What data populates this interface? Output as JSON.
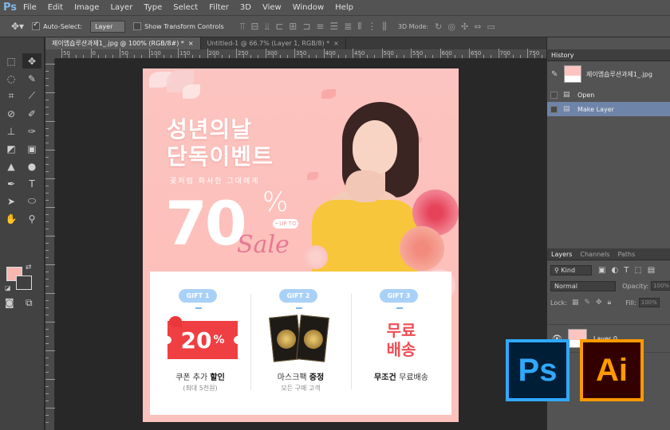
{
  "app": {
    "logo": "Ps"
  },
  "menu": [
    "File",
    "Edit",
    "Image",
    "Layer",
    "Type",
    "Select",
    "Filter",
    "3D",
    "View",
    "Window",
    "Help"
  ],
  "options": {
    "auto_select_label": "Auto-Select:",
    "auto_select_checked": true,
    "target_value": "Layer",
    "transform_label": "Show Transform Controls",
    "mode3d_label": "3D Mode:"
  },
  "tabs": [
    {
      "label": "제이엠숍루션과제1_.jpg @ 100% (RGB/8#) *",
      "active": true
    },
    {
      "label": "Untitled-1 @ 66.7% (Layer 1, RGB/8) *",
      "active": false
    }
  ],
  "ruler": {
    "h_labels": [
      "50",
      "0",
      "50",
      "100",
      "150",
      "200",
      "250",
      "300",
      "350",
      "400",
      "450",
      "500",
      "550",
      "600",
      "650",
      "700",
      "750"
    ]
  },
  "colors": {
    "foreground": "#f7b7b0",
    "background": "#404040",
    "artboard_pink": "#fcc4c0",
    "coupon_red": "#ef3f42",
    "gift_pill": "#a9d1f7",
    "ps_blue": "#31a8ff",
    "ai_orange": "#ff9a00"
  },
  "promo": {
    "headline_line1": "성년의날",
    "headline_line2": "단독이벤트",
    "subline": "꽃처럼 화사한 그대에게",
    "big_number": "70",
    "percent": "%",
    "upto": "~UP TO",
    "sale": "Sale",
    "gifts": [
      {
        "pill": "GIFT 1",
        "coupon_value": "20",
        "coupon_unit": "%",
        "title_plain": "쿠폰 추가 ",
        "title_bold": "할인",
        "sub": "(최대 5천원)"
      },
      {
        "pill": "GIFT 2",
        "title_plain": "마스크팩 ",
        "title_bold": "증정",
        "sub": "모든 구매 고객"
      },
      {
        "pill": "GIFT 3",
        "free_line1": "무료",
        "free_line2": "배송",
        "title_plain": "무료배송",
        "title_bold": "무조건 ",
        "sub": ""
      }
    ]
  },
  "history": {
    "tab": "History",
    "snapshot_name": "제이엠숍루션과제1_.jpg",
    "items": [
      {
        "label": "Open",
        "selected": false
      },
      {
        "label": "Make Layer",
        "selected": true
      }
    ]
  },
  "layers": {
    "tabs": [
      "Layers",
      "Channels",
      "Paths"
    ],
    "kind": "Kind",
    "blend_mode": "Normal",
    "opacity_label": "Opacity:",
    "opacity_value": "100%",
    "lock_label": "Lock:",
    "fill_label": "Fill:",
    "fill_value": "100%",
    "layer_name": "Layer 0"
  },
  "badges": {
    "ps": "Ps",
    "ai": "Ai"
  }
}
